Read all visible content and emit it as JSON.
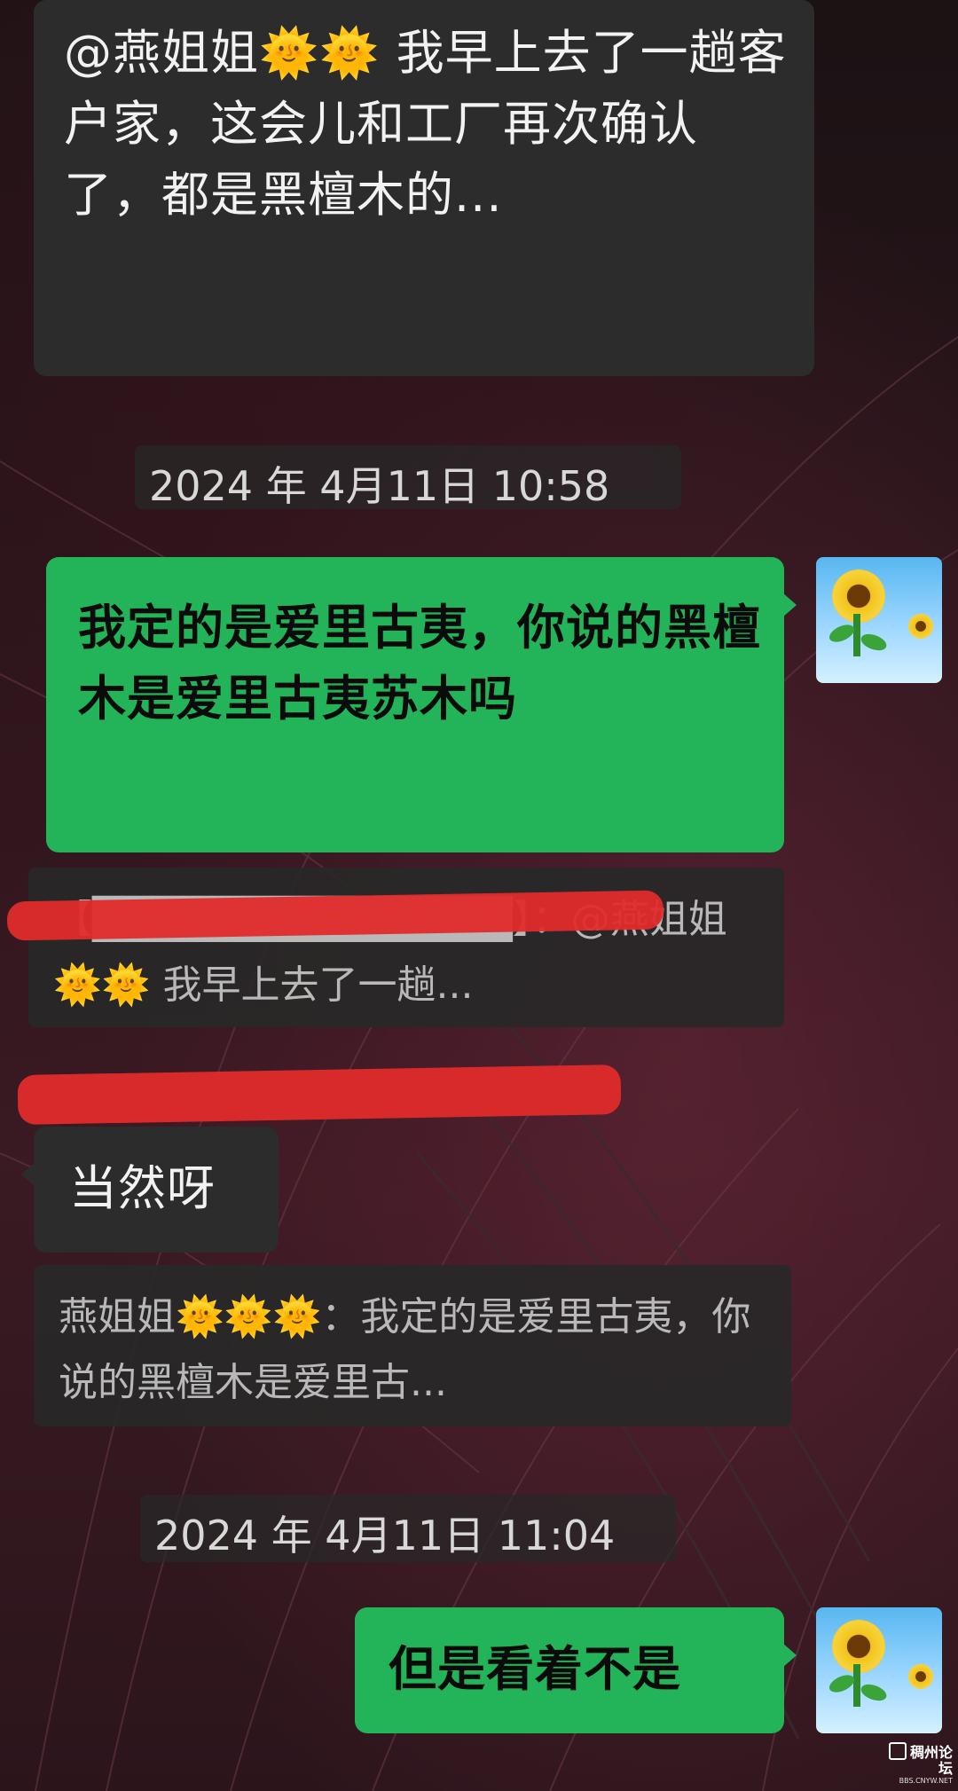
{
  "messages": {
    "m1": {
      "text": "@燕姐姐🌞🌞 我早上去了一趟客户家，这会儿和工厂再次确认了，都是黑檀木的..."
    },
    "ts1": "2024 年 4月11日 10:58",
    "m2": {
      "text": "我定的是爱里古夷，你说的黑檀木是爱里古夷苏木吗"
    },
    "q1": {
      "text": "【██████████████】：@燕姐姐🌞🌞 我早上去了一趟..."
    },
    "m3": {
      "text": "当然呀"
    },
    "q2": {
      "text": "燕姐姐🌞🌞🌞：我定的是爱里古夷，你说的黑檀木是爱里古..."
    },
    "ts2": "2024 年 4月11日 11:04",
    "m4": {
      "text": "但是看着不是"
    }
  },
  "avatars": {
    "self": {
      "icon": "sunflower-avatar"
    }
  },
  "watermark": {
    "name": "稠州论坛",
    "url": "BBS.CNYW.NET"
  },
  "colors": {
    "right_bubble": "#23b45a",
    "left_bubble": "#2c2c2c",
    "redaction": "#e02b2b"
  }
}
